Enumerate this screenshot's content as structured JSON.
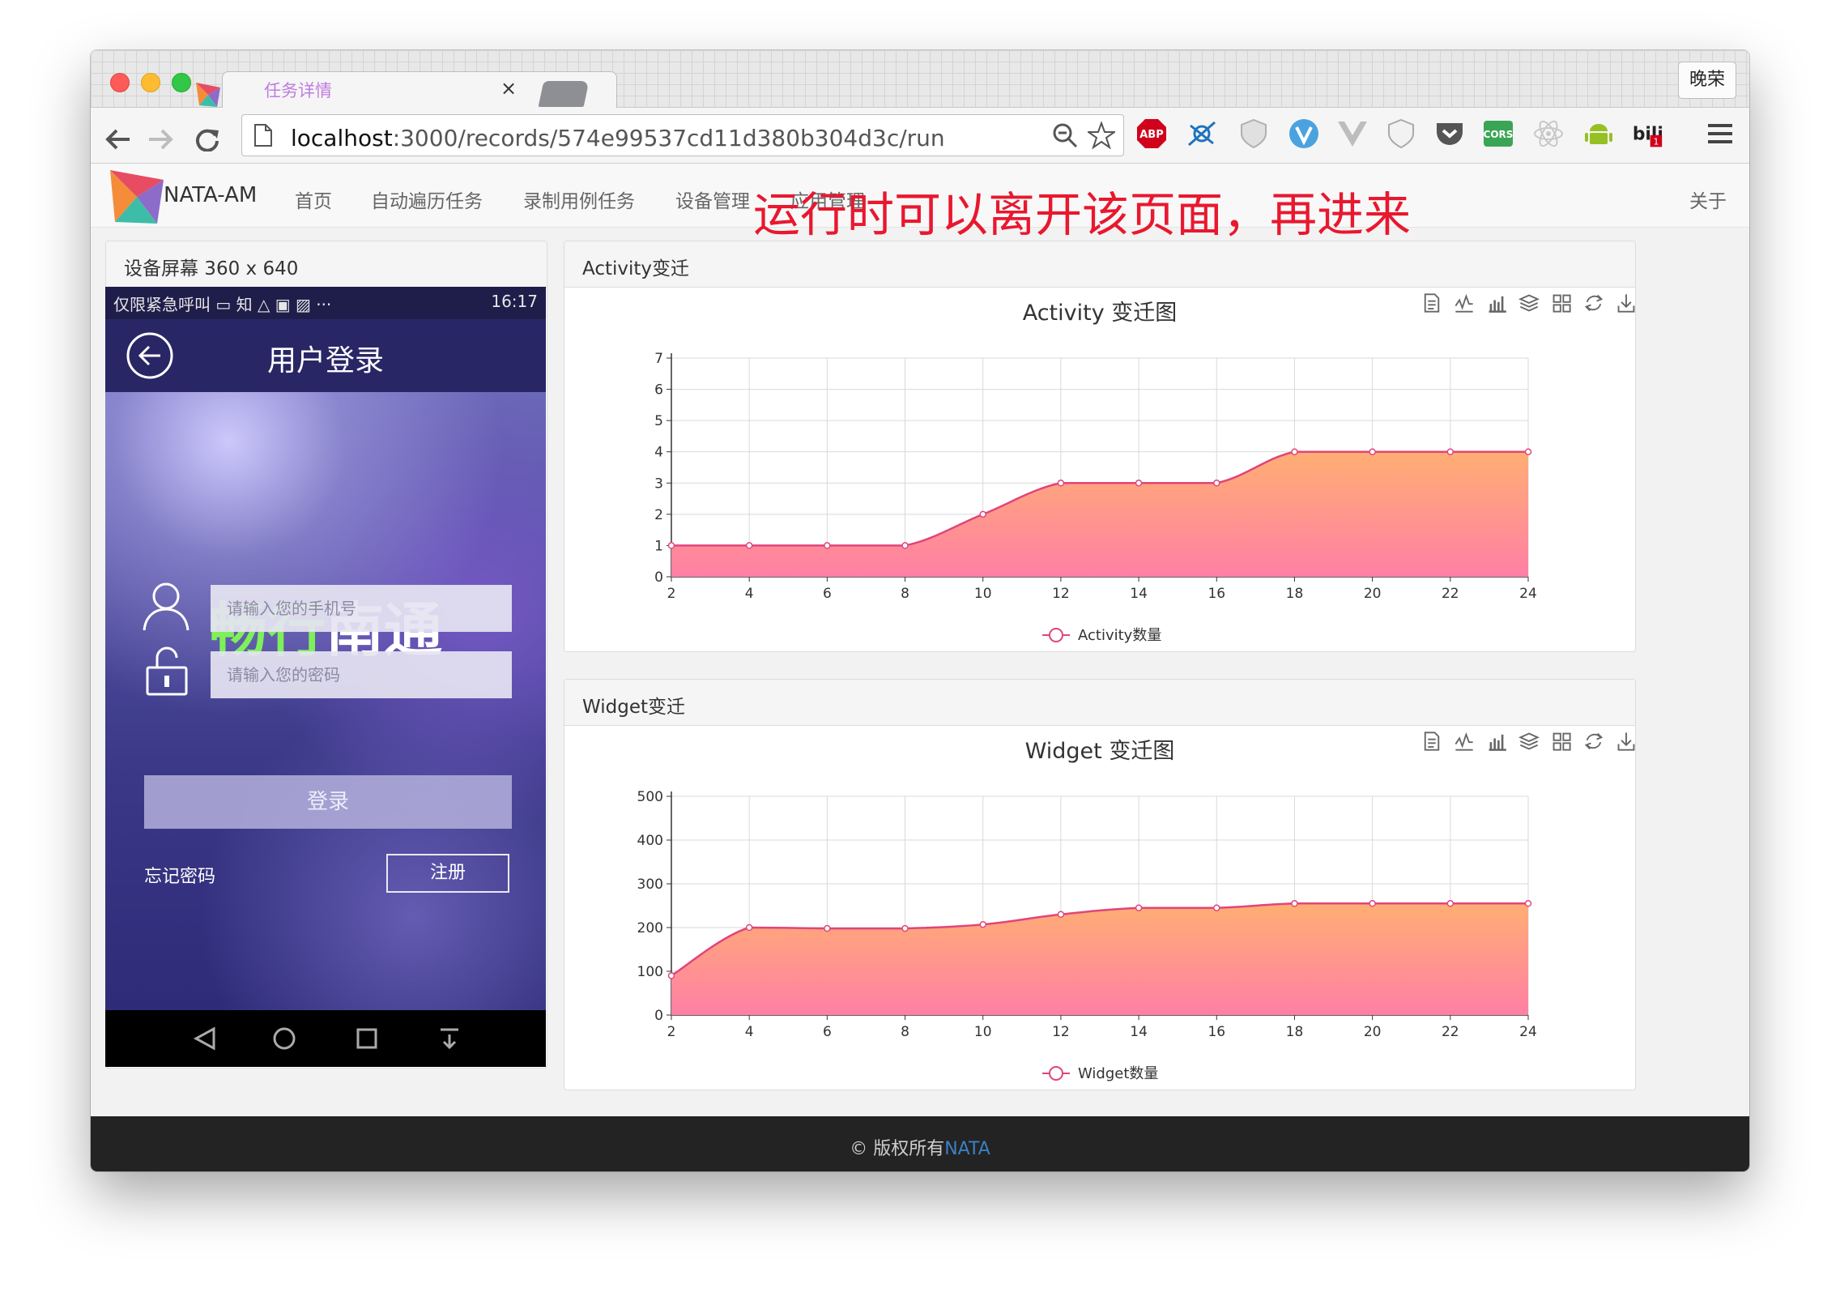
{
  "browser": {
    "tab_title": "任务详情",
    "tab_close": "×",
    "profile_name": "晚荣",
    "url_host": "localhost",
    "url_rest": ":3000/records/574e99537cd11d380b304d3c/run",
    "extensions": [
      "zoom-icon",
      "bookmark-star-icon",
      "adblock-plus-icon",
      "crosshair-icon",
      "shield-badge-icon",
      "vimium-icon",
      "vue-devtools-icon",
      "privacy-shield-icon",
      "pocket-icon",
      "cors-icon",
      "react-devtools-icon",
      "android-icon",
      "bilibili-icon",
      "menu-icon"
    ],
    "adblock_label": "ABP",
    "cors_label": "CORS",
    "bili_badge": "1"
  },
  "navbar": {
    "brand": "NATA-AM",
    "items": [
      "首页",
      "自动遍历任务",
      "录制用例任务",
      "设备管理",
      "应用管理"
    ],
    "right": "关于"
  },
  "device_panel": {
    "title": "设备屏幕 360 x 640"
  },
  "phone": {
    "status_left": "仅限紧急呼叫 ▭ 知 △ ▣ ▨ ···",
    "status_time": "16:17",
    "page_title": "用户登录",
    "logo_green": "畅行",
    "logo_white": "南通",
    "phone_placeholder": "请输入您的手机号",
    "password_placeholder": "请输入您的密码",
    "login_button": "登录",
    "forgot_password": "忘记密码",
    "register_button": "注册"
  },
  "annotation": "运行时可以离开该页面，再进来",
  "activity_panel": {
    "title": "Activity变迁",
    "chart_title": "Activity 变迁图"
  },
  "widget_panel": {
    "title": "Widget变迁",
    "chart_title": "Widget 变迁图"
  },
  "chart_data": [
    {
      "type": "area",
      "title": "Activity 变迁图",
      "x": [
        2,
        4,
        6,
        8,
        10,
        12,
        14,
        16,
        18,
        20,
        22,
        24
      ],
      "series": [
        {
          "name": "Activity数量",
          "values": [
            1,
            1,
            1,
            1,
            2,
            3,
            3,
            3,
            4,
            4,
            4,
            4
          ]
        }
      ],
      "xlim": [
        2,
        24
      ],
      "ylim": [
        0,
        7
      ],
      "yticks": [
        0,
        1,
        2,
        3,
        4,
        5,
        6,
        7
      ],
      "grid": true,
      "smooth": true,
      "legend": "bottom-center",
      "colors": {
        "line": "#e0457b",
        "fill_top": "#ffae73",
        "fill_bottom": "#ff7fa5"
      }
    },
    {
      "type": "area",
      "title": "Widget 变迁图",
      "x": [
        2,
        4,
        6,
        8,
        10,
        12,
        14,
        16,
        18,
        20,
        22,
        24
      ],
      "series": [
        {
          "name": "Widget数量",
          "values": [
            90,
            200,
            198,
            198,
            207,
            230,
            245,
            245,
            255,
            255,
            255,
            255
          ]
        }
      ],
      "xlim": [
        2,
        24
      ],
      "ylim": [
        0,
        500
      ],
      "yticks": [
        0,
        100,
        200,
        300,
        400,
        500
      ],
      "grid": true,
      "smooth": true,
      "legend": "bottom-center",
      "colors": {
        "line": "#e0457b",
        "fill_top": "#ffae73",
        "fill_bottom": "#ff7fa5"
      }
    }
  ],
  "toolbox_icons": [
    "data-view-icon",
    "line-chart-icon",
    "bar-chart-icon",
    "stack-icon",
    "tiled-icon",
    "restore-icon",
    "save-image-icon"
  ],
  "footer": {
    "copyright": "© 版权所有",
    "link": "NATA"
  }
}
